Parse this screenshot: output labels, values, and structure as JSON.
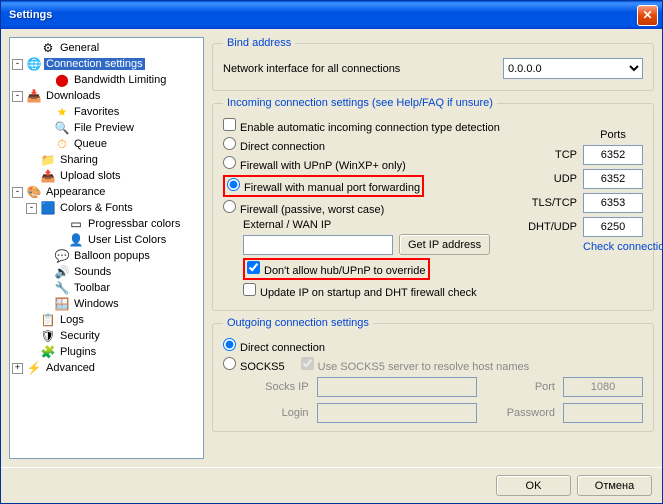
{
  "title": "Settings",
  "tree": {
    "general": "General",
    "connection": "Connection settings",
    "bandwidth": "Bandwidth Limiting",
    "downloads": "Downloads",
    "favorites": "Favorites",
    "filepreview": "File Preview",
    "queue": "Queue",
    "sharing": "Sharing",
    "uploadslots": "Upload slots",
    "appearance": "Appearance",
    "colorsfonts": "Colors & Fonts",
    "progressbar": "Progressbar colors",
    "userlist": "User List Colors",
    "balloon": "Balloon popups",
    "sounds": "Sounds",
    "toolbar": "Toolbar",
    "windows": "Windows",
    "logs": "Logs",
    "security": "Security",
    "plugins": "Plugins",
    "advanced": "Advanced"
  },
  "bind": {
    "legend": "Bind address",
    "label": "Network interface for all connections",
    "value": "0.0.0.0"
  },
  "incoming": {
    "legend": "Incoming connection settings (see Help/FAQ if unsure)",
    "auto": "Enable automatic incoming connection type detection",
    "direct": "Direct connection",
    "upnp": "Firewall with UPnP (WinXP+ only)",
    "manual": "Firewall with manual port forwarding",
    "passive": "Firewall (passive, worst case)",
    "extip": "External / WAN IP",
    "getip": "Get IP address",
    "noover": "Don't allow hub/UPnP to override",
    "update": "Update IP on startup and DHT firewall check",
    "check": "Check connection",
    "portshdr": "Ports",
    "tcp": "TCP",
    "tcpv": "6352",
    "udp": "UDP",
    "udpv": "6352",
    "tlstcp": "TLS/TCP",
    "tlstcpv": "6353",
    "dhtudp": "DHT/UDP",
    "dhtudpv": "6250"
  },
  "outgoing": {
    "legend": "Outgoing connection settings",
    "direct": "Direct connection",
    "socks5": "SOCKS5",
    "resolve": "Use SOCKS5 server to resolve host names",
    "socksip": "Socks IP",
    "port": "Port",
    "portv": "1080",
    "login": "Login",
    "password": "Password"
  },
  "buttons": {
    "ok": "OK",
    "cancel": "Отмена"
  }
}
